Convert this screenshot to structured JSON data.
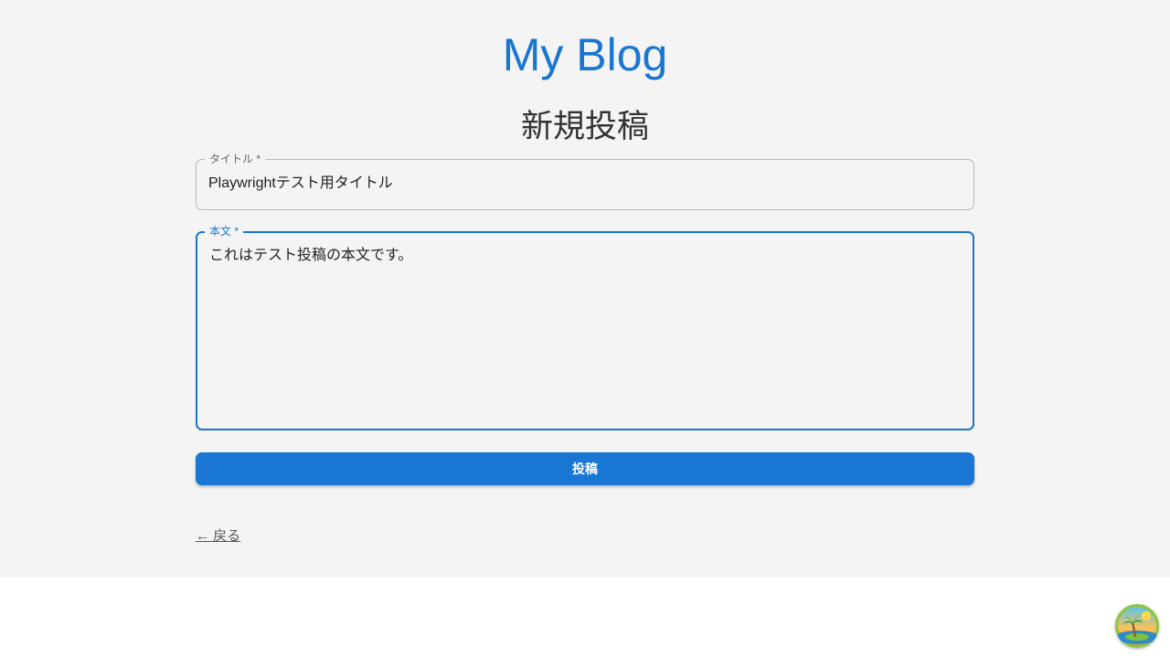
{
  "header": {
    "blog_title": "My Blog"
  },
  "form": {
    "heading": "新規投稿",
    "title_field": {
      "label": "タイトル *",
      "value": "Playwrightテスト用タイトル"
    },
    "body_field": {
      "label": "本文 *",
      "value": "これはテスト投稿の本文です。"
    },
    "submit_label": "投稿"
  },
  "footer": {
    "back_link": "← 戻る"
  },
  "floating": {
    "icon": "island-palm-icon"
  },
  "colors": {
    "accent": "#1976d2",
    "page_background": "#f4f4f4",
    "heading_text": "#333333"
  }
}
